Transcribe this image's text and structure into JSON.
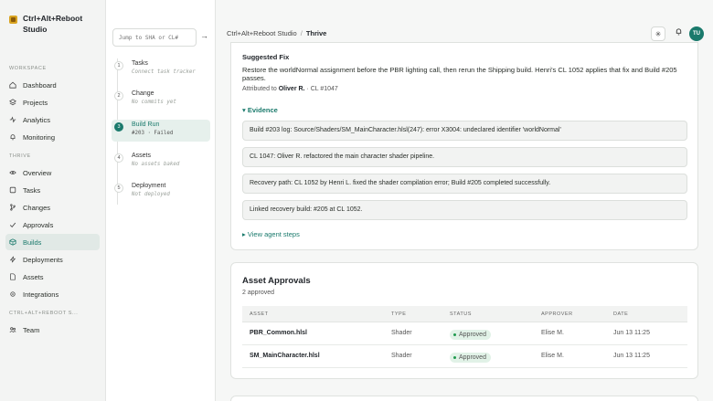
{
  "brand": {
    "name": "Ctrl+Alt+Reboot Studio"
  },
  "sidebar": {
    "workspace_label": "WORKSPACE",
    "workspace_items": [
      {
        "label": "Dashboard",
        "icon": "home-icon"
      },
      {
        "label": "Projects",
        "icon": "layers-icon"
      },
      {
        "label": "Analytics",
        "icon": "activity-icon"
      },
      {
        "label": "Monitoring",
        "icon": "bell-icon"
      }
    ],
    "project_label": "THRIVE",
    "project_items": [
      {
        "label": "Overview",
        "icon": "eye-icon"
      },
      {
        "label": "Tasks",
        "icon": "box-icon"
      },
      {
        "label": "Changes",
        "icon": "git-branch-icon"
      },
      {
        "label": "Approvals",
        "icon": "check-icon"
      },
      {
        "label": "Builds",
        "icon": "cube-icon",
        "active": true
      },
      {
        "label": "Deployments",
        "icon": "bolt-icon"
      },
      {
        "label": "Assets",
        "icon": "file-icon"
      },
      {
        "label": "Integrations",
        "icon": "gear-icon"
      }
    ],
    "org_label": "CTRL+ALT+REBOOT S...",
    "org_items": [
      {
        "label": "Team",
        "icon": "users-icon"
      }
    ]
  },
  "steps": {
    "jump_placeholder": "Jump to SHA or CL#",
    "items": [
      {
        "num": "1",
        "title": "Tasks",
        "sub": "Connect task tracker"
      },
      {
        "num": "2",
        "title": "Change",
        "sub": "No commits yet"
      },
      {
        "num": "3",
        "title": "Build Run",
        "sub": "#203 · Failed",
        "active": true
      },
      {
        "num": "4",
        "title": "Assets",
        "sub": "No assets baked"
      },
      {
        "num": "5",
        "title": "Deployment",
        "sub": "Not deployed"
      }
    ]
  },
  "topbar": {
    "crumb_org": "Ctrl+Alt+Reboot Studio",
    "crumb_sep": "/",
    "crumb_project": "Thrive",
    "avatar_initials": "TU"
  },
  "fix": {
    "label": "Suggested Fix",
    "text": "Restore the worldNormal assignment before the PBR lighting call, then rerun the Shipping build. Henri's CL 1052 applies that fix and Build #205 passes.",
    "attributed_prefix": "Attributed to",
    "attributed_name": "Oliver R.",
    "attributed_suffix": "· CL #1047",
    "evidence_label": "Evidence",
    "evidence": [
      "Build #203 log: Source/Shaders/SM_MainCharacter.hlsl(247): error X3004: undeclared identifier 'worldNormal'",
      "CL 1047: Oliver R. refactored the main character shader pipeline.",
      "Recovery path: CL 1052 by Henri L. fixed the shader compilation error; Build #205 completed successfully.",
      "Linked recovery build: #205 at CL 1052."
    ],
    "agent_steps_label": "View agent steps"
  },
  "approvals": {
    "title": "Asset Approvals",
    "subtitle": "2 approved",
    "columns": [
      "ASSET",
      "TYPE",
      "STATUS",
      "APPROVER",
      "DATE"
    ],
    "rows": [
      {
        "asset": "PBR_Common.hlsl",
        "type": "Shader",
        "status": "Approved",
        "approver": "Elise M.",
        "date": "Jun 13 11:25"
      },
      {
        "asset": "SM_MainCharacter.hlsl",
        "type": "Shader",
        "status": "Approved",
        "approver": "Elise M.",
        "date": "Jun 13 11:25"
      }
    ]
  },
  "colors": {
    "accent": "#1a7a6c",
    "approved_bg": "#e1f2e7",
    "approved_fg": "#1f7a40"
  }
}
